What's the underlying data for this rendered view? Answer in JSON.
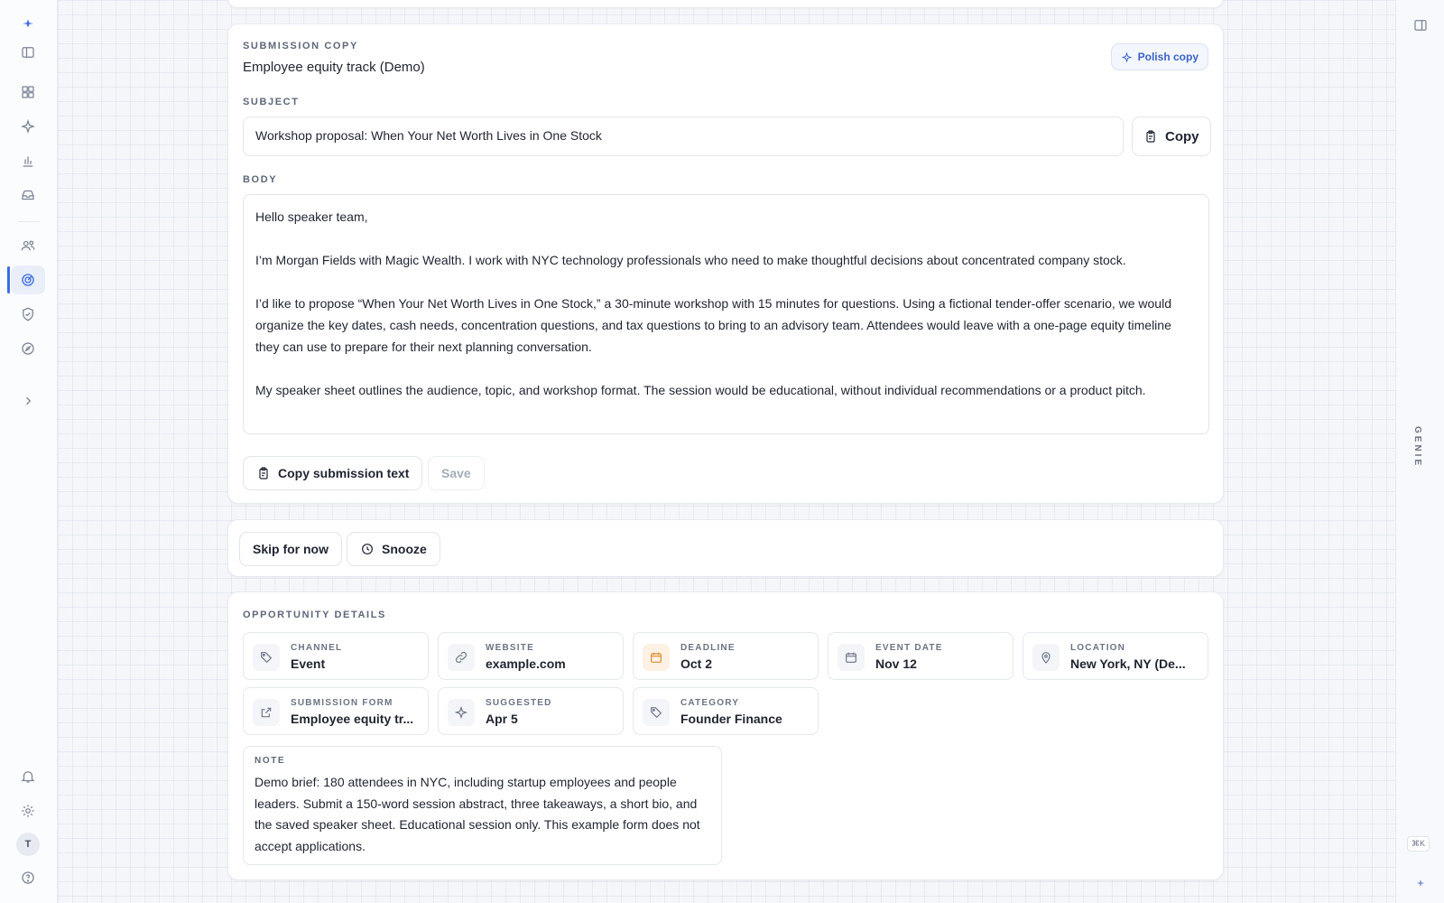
{
  "submission": {
    "eyebrow": "SUBMISSION COPY",
    "title": "Employee equity track (Demo)",
    "polish_label": "Polish copy",
    "subject_label": "SUBJECT",
    "subject_value": "Workshop proposal: When Your Net Worth Lives in One Stock",
    "copy_label": "Copy",
    "body_label": "BODY",
    "body_value": "Hello speaker team,\n\nI’m Morgan Fields with Magic Wealth. I work with NYC technology professionals who need to make thoughtful decisions about concentrated company stock.\n\nI’d like to propose “When Your Net Worth Lives in One Stock,” a 30-minute workshop with 15 minutes for questions. Using a fictional tender-offer scenario, we would organize the key dates, cash needs, concentration questions, and tax questions to bring to an advisory team. Attendees would leave with a one-page equity timeline they can use to prepare for their next planning conversation.\n\nMy speaker sheet outlines the audience, topic, and workshop format. The session would be educational, without individual recommendations or a product pitch.",
    "copy_submission_label": "Copy submission text",
    "save_label": "Save"
  },
  "actions": {
    "skip_label": "Skip for now",
    "snooze_label": "Snooze"
  },
  "details": {
    "eyebrow": "OPPORTUNITY DETAILS",
    "tiles": [
      {
        "label": "CHANNEL",
        "value": "Event",
        "icon": "tag-icon"
      },
      {
        "label": "WEBSITE",
        "value": "example.com",
        "icon": "link-icon"
      },
      {
        "label": "DEADLINE",
        "value": "Oct 2",
        "icon": "calendar-icon"
      },
      {
        "label": "EVENT DATE",
        "value": "Nov 12",
        "icon": "calendar-icon"
      },
      {
        "label": "LOCATION",
        "value": "New York, NY (De...",
        "icon": "location-pin-icon"
      },
      {
        "label": "SUBMISSION FORM",
        "value": "Employee equity tr...",
        "icon": "external-link-icon"
      },
      {
        "label": "SUGGESTED",
        "value": "Apr 5",
        "icon": "sparkle-icon"
      },
      {
        "label": "CATEGORY",
        "value": "Founder Finance",
        "icon": "tag-icon"
      }
    ],
    "note_label": "NOTE",
    "note_value": "Demo brief: 180 attendees in NYC, including startup employees and people leaders. Submit a 150-word session abstract, three takeaways, a short bio, and the saved speaker sheet. Educational session only. This example form does not accept applications."
  },
  "user": {
    "initial": "T"
  },
  "genie": {
    "label": "GENIE",
    "shortcut": "⌘K"
  },
  "colors": {
    "accent": "#3c6de0",
    "deadline_orange": "#e08a2f"
  }
}
